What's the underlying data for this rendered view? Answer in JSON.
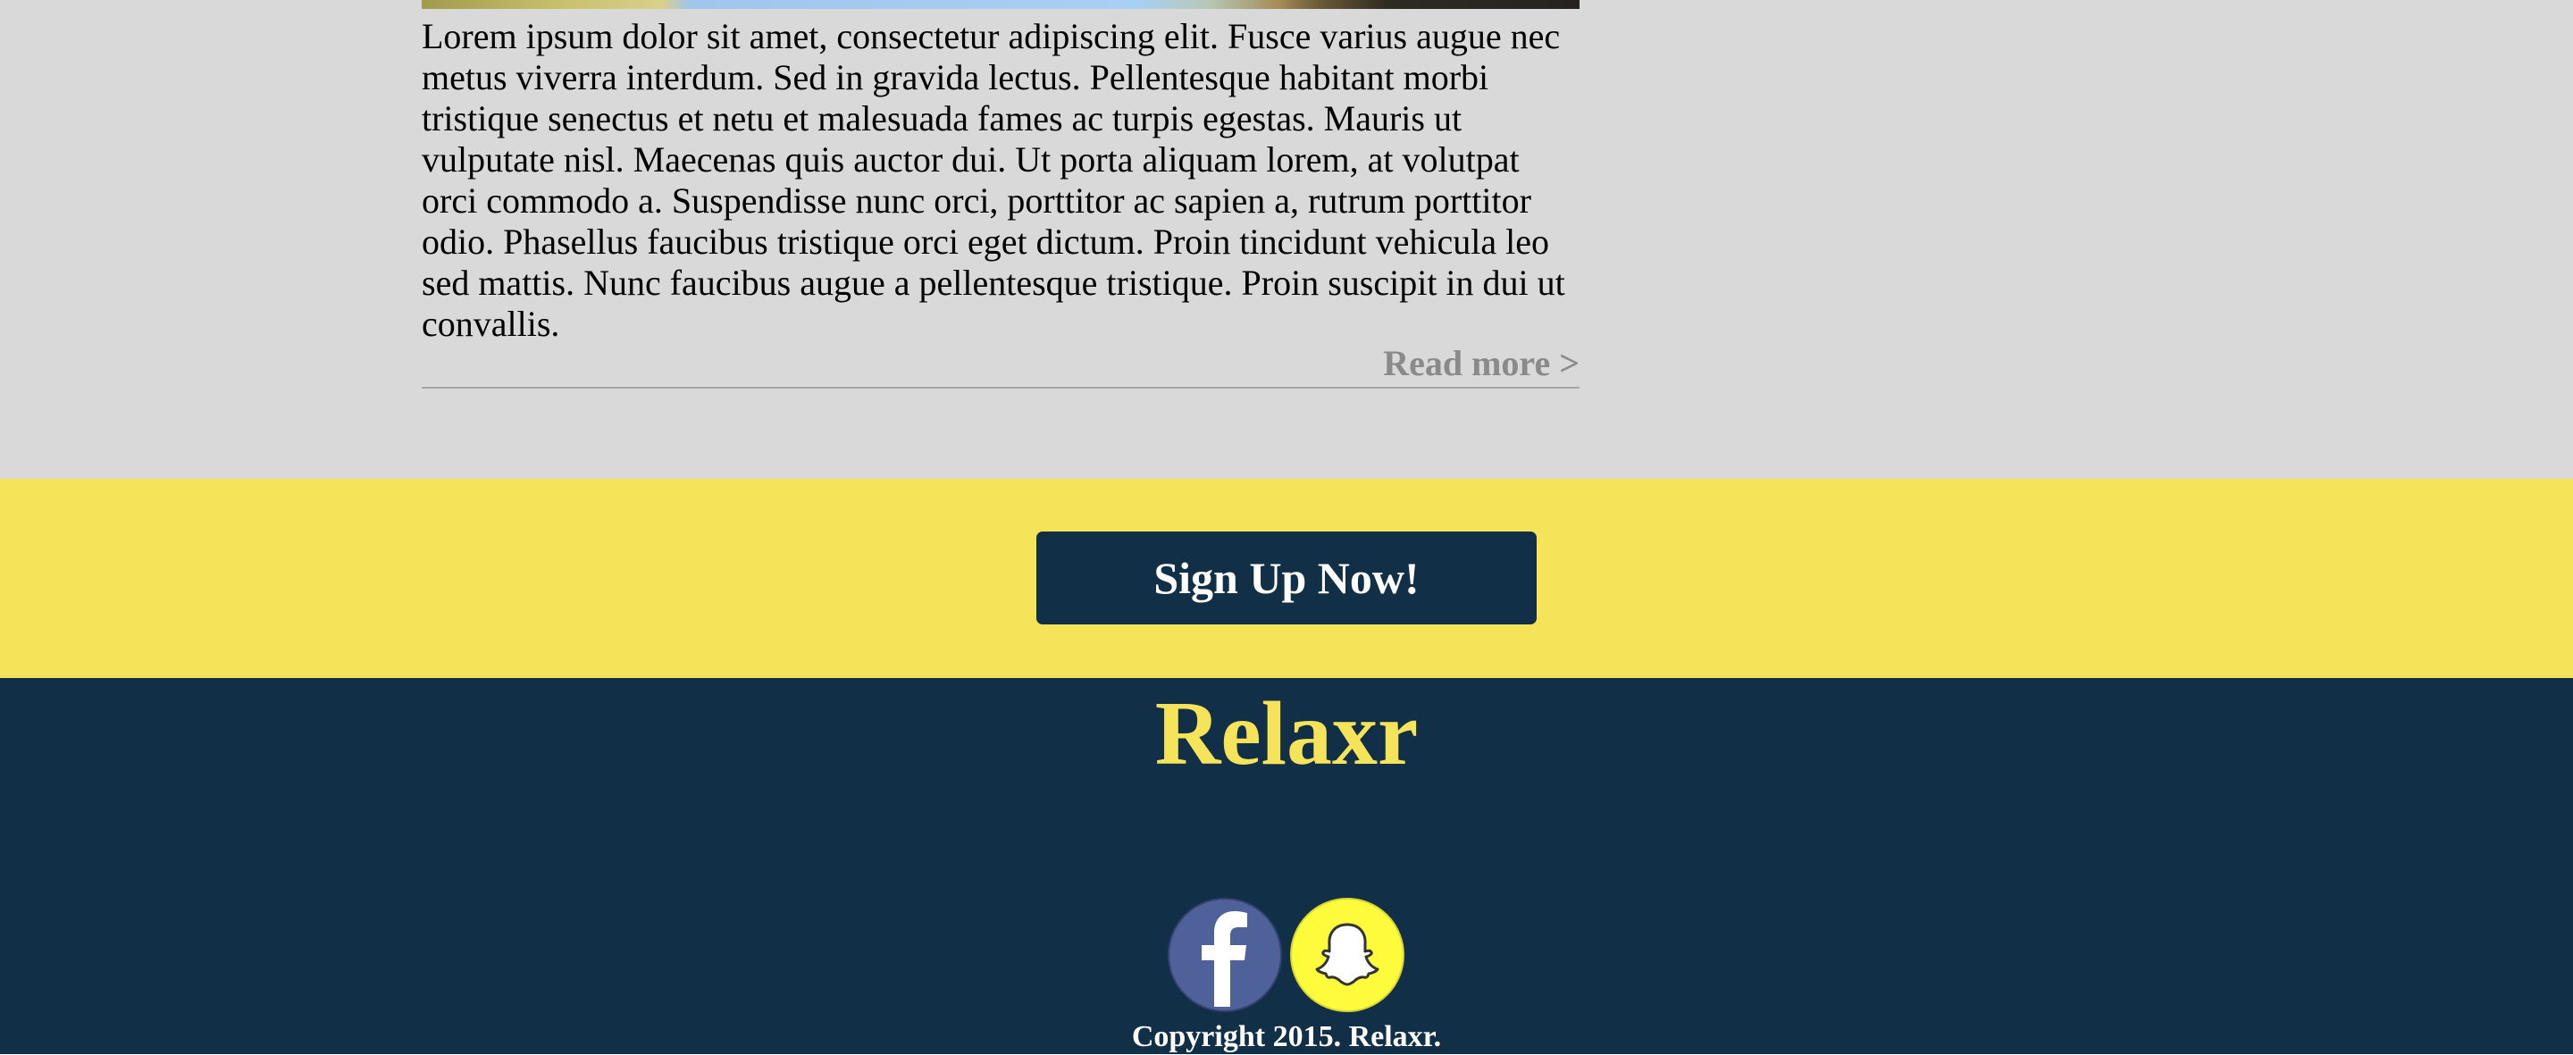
{
  "article": {
    "body": "Lorem ipsum dolor sit amet, consectetur adipiscing elit. Fusce varius augue nec metus viverra interdum. Sed in gravida lectus. Pellentesque habitant morbi tristique senectus et netu et malesuada fames ac turpis egestas. Mauris ut vulputate nisl. Maecenas quis auctor dui. Ut porta aliquam lorem, at volutpat orci commodo a. Suspendisse nunc orci, porttitor ac sapien a, rutrum porttitor odio. Phasellus faucibus tristique orci eget dictum. Proin tincidunt vehicula leo sed mattis. Nunc faucibus augue a pellentesque tristique. Proin suscipit in dui ut convallis.",
    "read_more": "Read more >"
  },
  "signup": {
    "button_label": "Sign Up Now!"
  },
  "footer": {
    "logo": "Relaxr",
    "social": [
      {
        "name": "facebook",
        "icon": "facebook-icon"
      },
      {
        "name": "snapchat",
        "icon": "snapchat-icon"
      }
    ],
    "copyright": "Copyright 2015. Relaxr."
  },
  "colors": {
    "page_background": "#d9d9d9",
    "accent_yellow": "#f5e35a",
    "navy": "#122f48",
    "read_more_gray": "#8a8a8a",
    "facebook_blue": "#4e6198",
    "snapchat_yellow": "#fdfb3b"
  }
}
